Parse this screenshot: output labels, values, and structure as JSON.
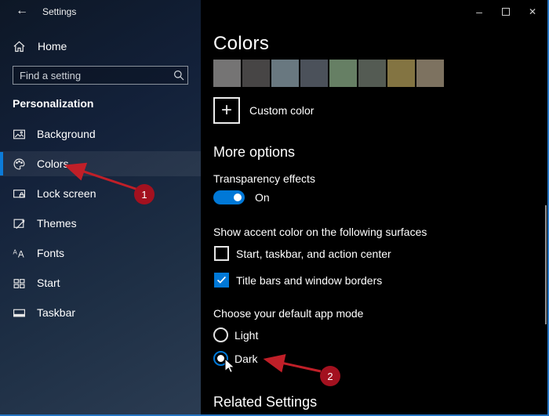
{
  "window": {
    "title": "Settings",
    "icons": {
      "back": "←",
      "minimize": "–",
      "maximize": "maximize-box",
      "close": "✕",
      "plus": "+",
      "search": "magnifier"
    },
    "colors": {
      "accent": "#0078d7",
      "window_border": "#2474c2",
      "annotation_red": "#a3111f",
      "panel_bg": "#000000"
    }
  },
  "sidebar": {
    "home_label": "Home",
    "search": {
      "placeholder": "Find a setting"
    },
    "section_header": "Personalization",
    "items": [
      {
        "id": "background",
        "label": "Background",
        "selected": false
      },
      {
        "id": "colors",
        "label": "Colors",
        "selected": true
      },
      {
        "id": "lock-screen",
        "label": "Lock screen",
        "selected": false
      },
      {
        "id": "themes",
        "label": "Themes",
        "selected": false
      },
      {
        "id": "fonts",
        "label": "Fonts",
        "selected": false
      },
      {
        "id": "start",
        "label": "Start",
        "selected": false
      },
      {
        "id": "taskbar",
        "label": "Taskbar",
        "selected": false
      }
    ]
  },
  "main": {
    "heading": "Colors",
    "swatches": [
      "#757474",
      "#474545",
      "#697880",
      "#4b515a",
      "#667f64",
      "#545b53",
      "#837442",
      "#7d7260"
    ],
    "custom_color_label": "Custom color",
    "more_options_heading": "More options",
    "transparency": {
      "label": "Transparency effects",
      "state_label": "On",
      "enabled": true
    },
    "accent_surfaces": {
      "label": "Show accent color on the following surfaces",
      "options": [
        {
          "label": "Start, taskbar, and action center",
          "checked": false
        },
        {
          "label": "Title bars and window borders",
          "checked": true
        }
      ]
    },
    "app_mode": {
      "label": "Choose your default app mode",
      "options": [
        {
          "label": "Light",
          "selected": false
        },
        {
          "label": "Dark",
          "selected": true
        }
      ]
    },
    "related_heading": "Related Settings"
  },
  "annotations": {
    "step1": "1",
    "step2": "2"
  }
}
